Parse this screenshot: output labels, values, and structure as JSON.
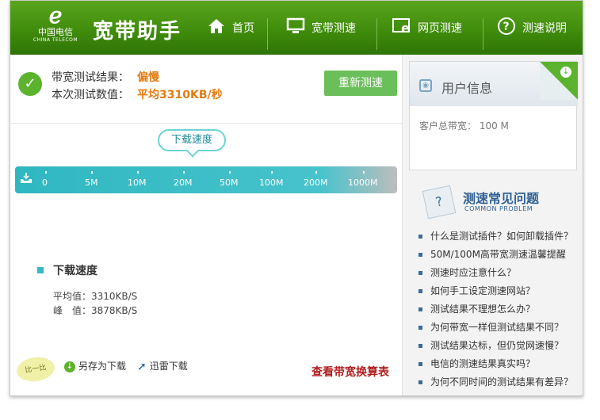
{
  "brand": {
    "logo_cn": "中国电信",
    "logo_en": "CHINA TELECOM"
  },
  "app_title": "宽带助手",
  "nav": [
    {
      "icon": "home-icon",
      "label": "首页"
    },
    {
      "icon": "monitor-icon",
      "label": "宽带测速"
    },
    {
      "icon": "browser-icon",
      "label": "网页测速"
    },
    {
      "icon": "help-icon",
      "label": "测速说明"
    }
  ],
  "result": {
    "label1": "带宽测试结果：",
    "value1": "偏慢",
    "label2": "本次测试数值：",
    "value2": "平均3310KB/秒",
    "retest": "重新测速"
  },
  "gauge": {
    "bubble": "下载速度",
    "ticks": [
      "0",
      "5M",
      "10M",
      "20M",
      "50M",
      "100M",
      "200M",
      "1000M"
    ]
  },
  "download": {
    "title": "下载速度",
    "avg": "平均值：3310KB/S",
    "peak": "峰　值：3878KB/S"
  },
  "bottom": {
    "badge": "比一比",
    "save": "另存为下载",
    "thunder": "迅雷下载",
    "table_link": "查看带宽换算表"
  },
  "user_info": {
    "title": "用户信息",
    "bandwidth": "客户总带宽： 100 M"
  },
  "faq": {
    "title": "测速常见问题",
    "subtitle": "COMMON PROBLEM",
    "items": [
      "什么是测试插件？如何卸载插件？",
      "50M/100M高带宽测速温馨提醒",
      "测速时应注意什么？",
      "如何手工设定测速网站？",
      "测试结果不理想怎么办？",
      "为何带宽一样但测试结果不同？",
      "测试结果达标，但仍觉网速慢？",
      "电信的测速结果真实吗？",
      "为何不同时间的测试结果有差异？"
    ]
  }
}
